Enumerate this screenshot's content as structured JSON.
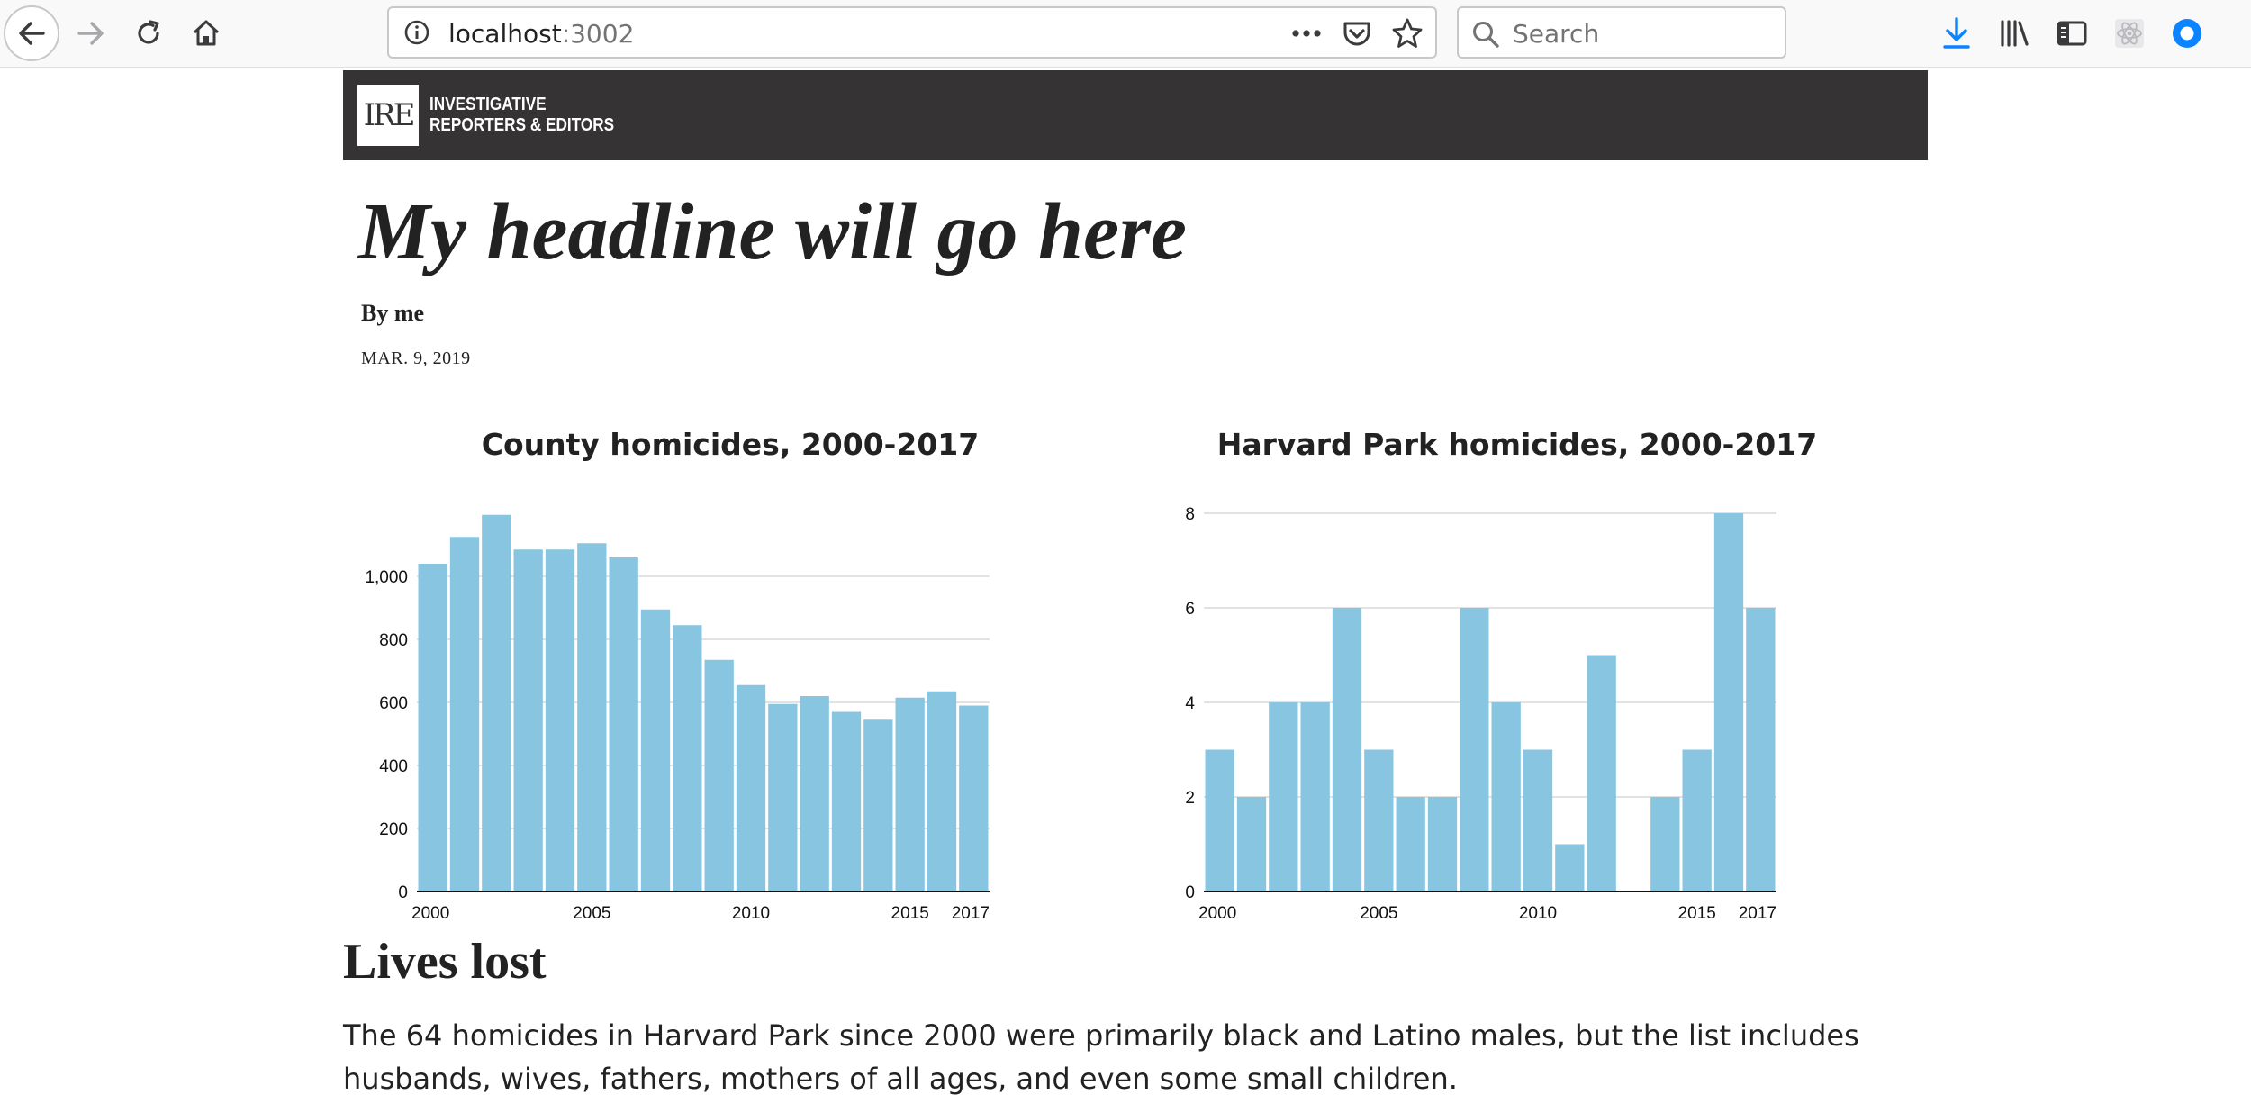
{
  "browser": {
    "url_host": "localhost",
    "url_port": ":3002",
    "search_placeholder": "Search"
  },
  "site": {
    "logo_mark": "IRE",
    "logo_line1": "INVESTIGATIVE",
    "logo_line2": "REPORTERS & EDITORS"
  },
  "article": {
    "headline": "My headline will go here",
    "byline": "By me",
    "date": "MAR. 9, 2019",
    "section_title": "Lives lost",
    "paragraph": "The 64 homicides in Harvard Park since 2000 were primarily black and Latino males, but the list includes husbands, wives, fathers, mothers of all ages, and even some small children."
  },
  "colors": {
    "bar": "#88c5e0",
    "masthead": "#353334",
    "grid": "#e2e2e2"
  },
  "chart_data": [
    {
      "type": "bar",
      "title": "County homicides, 2000-2017",
      "categories": [
        2000,
        2001,
        2002,
        2003,
        2004,
        2005,
        2006,
        2007,
        2008,
        2009,
        2010,
        2011,
        2012,
        2013,
        2014,
        2015,
        2016,
        2017
      ],
      "values": [
        1040,
        1125,
        1195,
        1085,
        1085,
        1105,
        1060,
        895,
        845,
        735,
        655,
        595,
        620,
        570,
        545,
        615,
        635,
        590
      ],
      "ylim": [
        0,
        1200
      ],
      "yticks": [
        0,
        200,
        400,
        600,
        800,
        1000
      ],
      "ytick_labels": [
        "0",
        "200",
        "400",
        "600",
        "800",
        "1,000"
      ],
      "xticks": [
        2000,
        2005,
        2010,
        2015,
        2017
      ],
      "xlabel": "",
      "ylabel": "",
      "grid": true
    },
    {
      "type": "bar",
      "title": "Harvard Park homicides, 2000-2017",
      "categories": [
        2000,
        2001,
        2002,
        2003,
        2004,
        2005,
        2006,
        2007,
        2008,
        2009,
        2010,
        2011,
        2012,
        2013,
        2014,
        2015,
        2016,
        2017
      ],
      "values": [
        3,
        2,
        4,
        4,
        6,
        3,
        2,
        2,
        6,
        4,
        3,
        1,
        5,
        0,
        2,
        3,
        8,
        6
      ],
      "ylim": [
        0,
        8
      ],
      "yticks": [
        0,
        2,
        4,
        6,
        8
      ],
      "ytick_labels": [
        "0",
        "2",
        "4",
        "6",
        "8"
      ],
      "xticks": [
        2000,
        2005,
        2010,
        2015,
        2017
      ],
      "xlabel": "",
      "ylabel": "",
      "grid": true
    }
  ]
}
